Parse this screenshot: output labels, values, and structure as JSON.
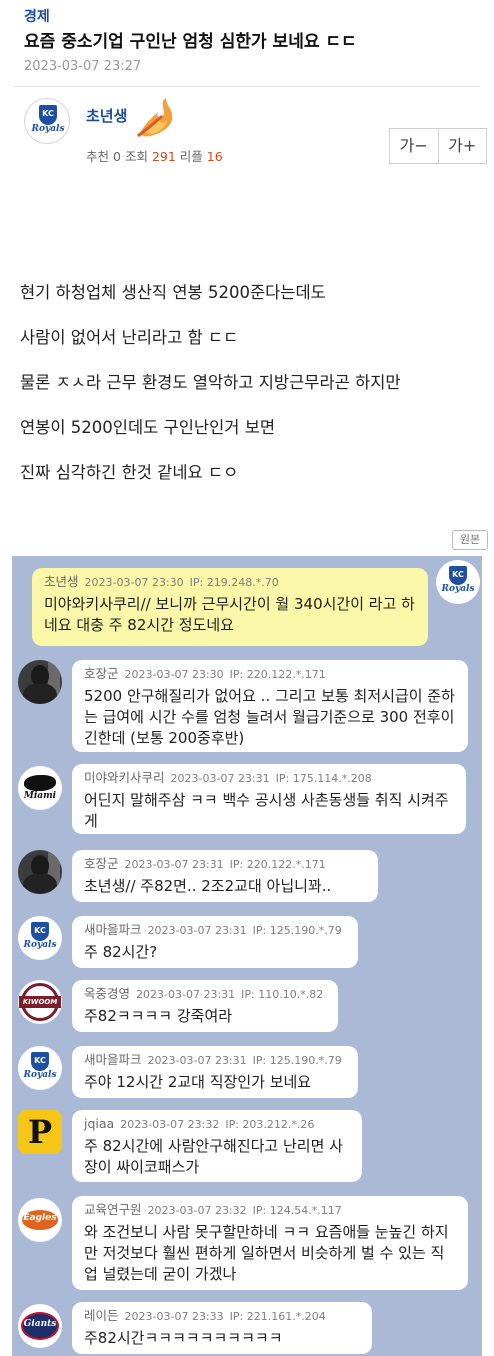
{
  "post": {
    "category": "경제",
    "title": "요즘 중소기업 구인난 엄청 심한가 보네요 ㄷㄷ",
    "date": "2023-03-07 23:27",
    "author": "초년생",
    "author_team_logo": "Royals",
    "stats": {
      "recommend_label": "추천",
      "recommend": "0",
      "views_label": "조회",
      "views": "291",
      "replies_label": "리플",
      "replies": "16"
    },
    "font_smaller": "가−",
    "font_larger": "가+",
    "body": [
      "현기 하청업체 생산직 연봉 5200준다는데도",
      "사람이 없어서 난리라고 함 ㄷㄷ",
      "물론 ㅈㅅ라 근무 환경도 열악하고 지방근무라곤 하지만",
      "연봉이 5200인데도 구인난인거 보면",
      "진짜 심각하긴 한것 같네요 ㄷㅇ"
    ],
    "original_button": "원본"
  },
  "comments": [
    {
      "nick": "초년생",
      "date": "2023-03-07 23:30",
      "ip": "IP: 219.248.*.70",
      "text": "미야와키사쿠리// 보니까 근무시간이 월 340시간이 라고 하네요 대충 주 82시간 정도네요",
      "logo": "Royals"
    },
    {
      "nick": "호장군",
      "date": "2023-03-07 23:30",
      "ip": "IP: 220.122.*.171",
      "text": "5200 안구해질리가 없어요 .. 그리고 보통 최저시급이 준하는 급여에 시간 수를 엄청 늘려서 월급기준으로 300 전후이긴한데 (보통 200중후반)",
      "logo": "photo"
    },
    {
      "nick": "미야와키사쿠리",
      "date": "2023-03-07 23:31",
      "ip": "IP: 175.114.*.208",
      "text": "어딘지 말해주삼 ㅋㅋ 백수 공시생 사촌동생들 취직 시켜주게",
      "logo": "Miami"
    },
    {
      "nick": "호장군",
      "date": "2023-03-07 23:31",
      "ip": "IP: 220.122.*.171",
      "text": "초년생// 주82면.. 2조2교대 아닙니꽈..",
      "logo": "photo"
    },
    {
      "nick": "새마을파크",
      "date": "2023-03-07 23:31",
      "ip": "IP: 125.190.*.79",
      "text": "주 82시간?",
      "logo": "Royals"
    },
    {
      "nick": "옥중경영",
      "date": "2023-03-07 23:31",
      "ip": "IP: 110.10.*.82",
      "text": "주82ㅋㅋㅋㅋ 강죽여라",
      "logo": "KIWOOM"
    },
    {
      "nick": "새마을파크",
      "date": "2023-03-07 23:31",
      "ip": "IP: 125.190.*.79",
      "text": "주야 12시간 2교대 직장인가 보네요",
      "logo": "Royals"
    },
    {
      "nick": "jqiaa",
      "date": "2023-03-07 23:32",
      "ip": "IP: 203.212.*.26",
      "text": "주 82시간에 사람안구해진다고 난리면 사장이 싸이코패스가",
      "logo": "P"
    },
    {
      "nick": "교육연구원",
      "date": "2023-03-07 23:32",
      "ip": "IP: 124.54.*.117",
      "text": "와 조건보니 사람 못구할만하네 ㅋㅋ 요즘애들 눈높긴 하지만 저것보다 훨씬 편하게 일하면서 비슷하게 벌 수 있는 직업 널렸는데 굳이 가겠나",
      "logo": "Eagles"
    },
    {
      "nick": "레이든",
      "date": "2023-03-07 23:33",
      "ip": "IP: 221.161.*.204",
      "text": "주82시간ㅋㅋㅋㅋㅋㅋㅋㅋㅋㅋ",
      "logo": "Giants"
    }
  ]
}
